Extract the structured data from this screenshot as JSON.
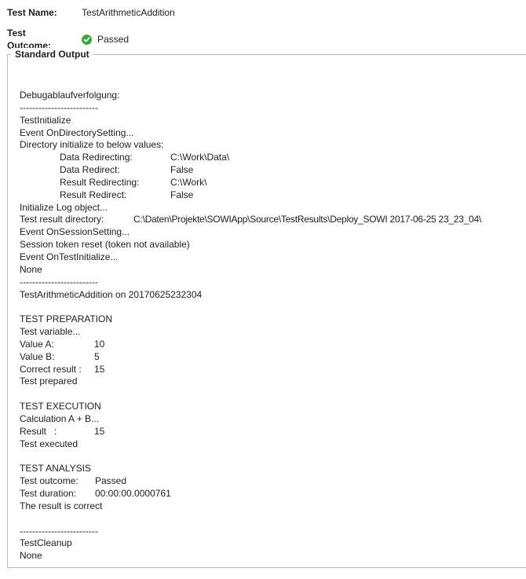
{
  "header": {
    "test_name_label": "Test Name:",
    "test_name_value": "TestArithmeticAddition",
    "test_outcome_label": "Test Outcome:",
    "test_outcome_value": "Passed",
    "outcome_icon": "check-circle-icon",
    "outcome_color": "#3aa93a"
  },
  "group": {
    "title": "Standard Output"
  },
  "output": {
    "blank_1": "",
    "debug_heading": "Debugablaufverfolgung:",
    "separator_1": "-------------------------",
    "test_initialize": "TestInitialize",
    "event_dir": "Event OnDirectorySetting...",
    "dir_init": "Directory initialize to below values:",
    "data_redirecting_label": "Data Redirecting:",
    "data_redirecting_value": "C:\\Work\\Data\\",
    "data_redirect_label": "Data Redirect:",
    "data_redirect_value": "False",
    "result_redirecting_label": "Result Redirecting:",
    "result_redirecting_value": "C:\\Work\\",
    "result_redirect_label": "Result Redirect:",
    "result_redirect_value": "False",
    "init_log": "Initialize Log object...",
    "test_result_dir_label": "Test result directory:",
    "test_result_dir_value": "C:\\Daten\\Projekte\\SOWIApp\\Source\\TestResults\\Deploy_SOWI 2017-06-25 23_23_04\\",
    "event_session": "Event OnSessionSetting...",
    "session_token": "Session token reset (token not available)",
    "event_test_init": "Event OnTestInitialize...",
    "none_1": "None",
    "separator_2": "-------------------------",
    "test_run": "TestArithmeticAddition on 20170625232304",
    "prep_heading": "TEST PREPARATION",
    "test_variable": "Test variable...",
    "value_a_label": "Value A:",
    "value_a": "10",
    "value_b_label": "Value B:",
    "value_b": "5",
    "correct_result_label": "Correct result :",
    "correct_result": "15",
    "test_prepared": "Test prepared",
    "exec_heading": "TEST EXECUTION",
    "calculation": "Calculation A + B...",
    "result_label": "Result   :",
    "result_value": "15",
    "test_executed": "Test executed",
    "analysis_heading": "TEST ANALYSIS",
    "test_outcome_label": "Test outcome:",
    "test_outcome_value": "Passed",
    "test_duration_label": "Test duration:",
    "test_duration_value": "00:00:00.0000761",
    "result_correct": "The result is correct",
    "separator_3": "-------------------------",
    "test_cleanup": "TestCleanup",
    "none_2": "None"
  }
}
